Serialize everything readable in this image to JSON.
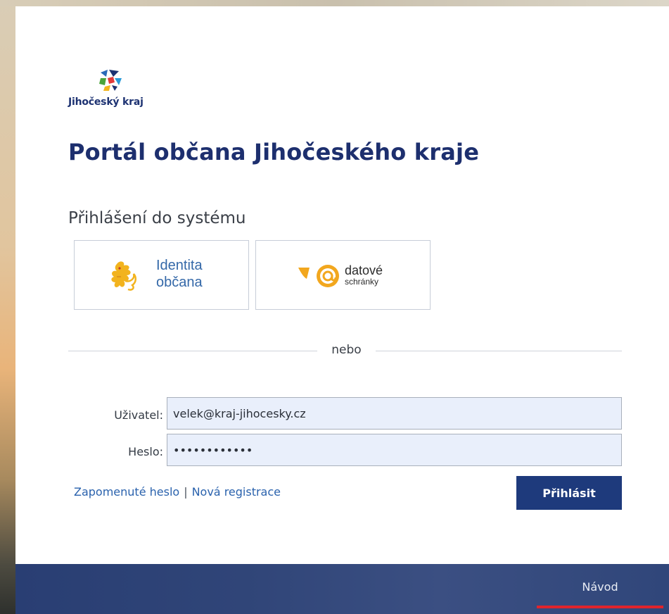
{
  "logo": {
    "text": "Jihočeský kraj"
  },
  "page": {
    "title": "Portál občana Jihočeského kraje"
  },
  "login": {
    "subtitle": "Přihlášení do systému",
    "identita": {
      "line1": "Identita",
      "line2": "občana"
    },
    "datove": {
      "line1": "datové",
      "line2": "schránky"
    },
    "divider_text": "nebo",
    "user_label": "Uživatel:",
    "user_value": "velek@kraj-jihocesky.cz",
    "pass_label": "Heslo:",
    "pass_value": "••••••••••••",
    "forgot_link": "Zapomenuté heslo",
    "link_separator": "|",
    "register_link": "Nová registrace",
    "submit_label": "Přihlásit"
  },
  "footer": {
    "guide_link": "Návod"
  },
  "colors": {
    "brand_navy": "#1e3a7c",
    "link_blue": "#2a62ad",
    "accent_red": "#e0242c"
  }
}
